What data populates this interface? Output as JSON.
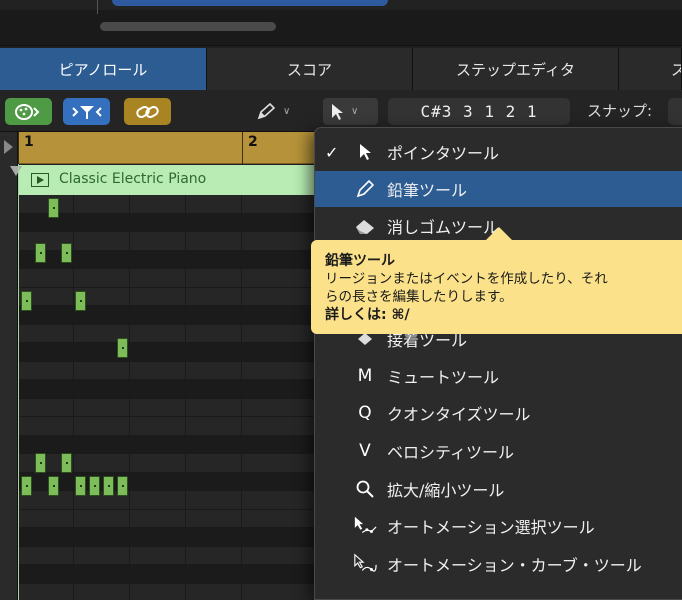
{
  "tabs": [
    {
      "label": "ピアノロール",
      "active": true
    },
    {
      "label": "スコア",
      "active": false
    },
    {
      "label": "ステップエディタ",
      "active": false
    },
    {
      "label": "ス",
      "active": false
    }
  ],
  "toolbar": {
    "lcd_value": "C#3   3 1 2 1",
    "snap_label": "スナップ:"
  },
  "ruler": {
    "bar1": "1",
    "bar2": "2"
  },
  "region": {
    "name": "Classic Electric Piano"
  },
  "menu": {
    "items": [
      {
        "label": "ポインタツール",
        "icon": "pointer-icon",
        "checked": true
      },
      {
        "label": "鉛筆ツール",
        "icon": "pencil-icon",
        "highlighted": true
      },
      {
        "label": "消しゴムツール",
        "icon": "eraser-icon"
      },
      {
        "label": "接着ツール",
        "icon": "glue-icon"
      },
      {
        "label": "ミュートツール",
        "icon": "mute-icon",
        "glyph": "M"
      },
      {
        "label": "クオンタイズツール",
        "icon": "quantize-icon",
        "glyph": "Q"
      },
      {
        "label": "ベロシティツール",
        "icon": "velocity-icon",
        "glyph": "V"
      },
      {
        "label": "拡大/縮小ツール",
        "icon": "zoom-icon"
      },
      {
        "label": "オートメーション選択ツール",
        "icon": "automation-select-icon"
      },
      {
        "label": "オートメーション・カーブ・ツール",
        "icon": "automation-curve-icon"
      }
    ]
  },
  "tooltip": {
    "title": "鉛筆ツール",
    "body_line1": "リージョンまたはイベントを作成したり、それ",
    "body_line2": "らの長さを編集したりします。",
    "more": "詳しくは: ⌘/"
  },
  "colors": {
    "accent": "#2d5c93",
    "region": "#b8ecb4",
    "ruler": "#b6933a",
    "note": "#7dbd59",
    "tooltip": "#fbe28a"
  }
}
